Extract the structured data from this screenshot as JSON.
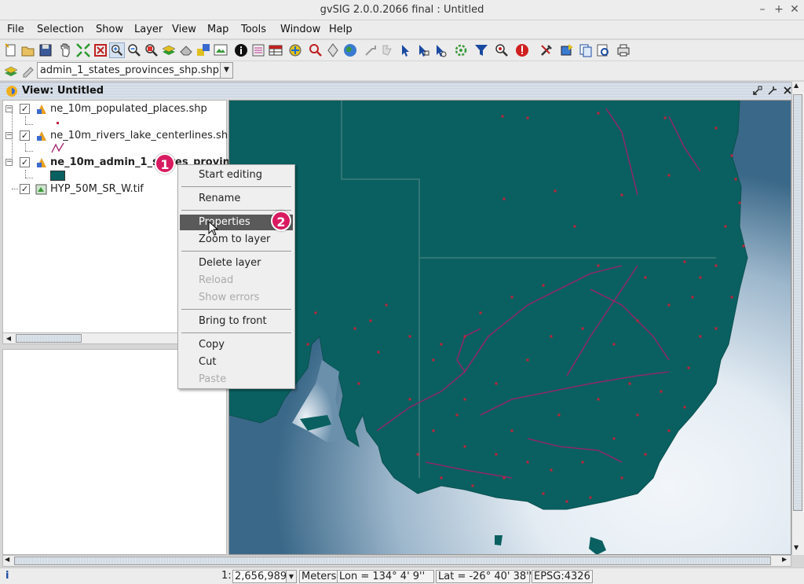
{
  "window": {
    "title": "gvSIG 2.0.0.2066 final : Untitled",
    "controls": [
      "–",
      "+",
      "✕"
    ]
  },
  "menubar": {
    "items": [
      "File",
      "Selection",
      "Show",
      "Layer",
      "View",
      "Map",
      "Tools",
      "Window",
      "Help"
    ]
  },
  "toolbar": {
    "active_layer_combo": "ne_10m_admin_1_states_provinces_shp.shp",
    "buttons": [
      "new-icon",
      "open-icon",
      "save-icon",
      "pan-icon",
      "zoom-extent-icon",
      "full-extent-icon",
      "zoom-in-icon",
      "zoom-out-icon",
      "zoom-select-icon",
      "layers-icon",
      "eraser-icon",
      "add-layer-icon",
      "map-frame-icon",
      "info-icon",
      "selection-icon",
      "table-icon",
      "locator-icon",
      "zoom-to-point-icon",
      "globe-icon",
      "geo-icon",
      "hyperlink-icon",
      "select-pointer-icon",
      "select-rect-icon",
      "select-polygon-icon",
      "gear-icon",
      "filter-icon",
      "error-icon",
      "tools-icon",
      "export-icon",
      "copy-icon",
      "preview-icon",
      "print-icon"
    ]
  },
  "view": {
    "title": "View: Untitled"
  },
  "toc": {
    "layers": [
      {
        "name": "ne_10m_populated_places.shp",
        "checked": true,
        "bold": false
      },
      {
        "name": "ne_10m_rivers_lake_centerlines.shp",
        "checked": true,
        "bold": false
      },
      {
        "name": "ne_10m_admin_1_states_provinces_shp.shp",
        "checked": true,
        "bold": true
      },
      {
        "name": "HYP_50M_SR_W.tif",
        "checked": true,
        "bold": false
      }
    ],
    "fill_color": "#0a6060"
  },
  "context_menu": {
    "items": [
      {
        "label": "Start editing",
        "enabled": true
      },
      {
        "label": "Rename",
        "enabled": true
      },
      {
        "label": "Properties",
        "enabled": true,
        "highlighted": true
      },
      {
        "label": "Zoom to layer",
        "enabled": true
      },
      {
        "label": "Delete layer",
        "enabled": true
      },
      {
        "label": "Reload",
        "enabled": false
      },
      {
        "label": "Show errors",
        "enabled": false
      },
      {
        "label": "Bring to front",
        "enabled": true
      },
      {
        "label": "Copy",
        "enabled": true
      },
      {
        "label": "Cut",
        "enabled": true
      },
      {
        "label": "Paste",
        "enabled": false
      }
    ]
  },
  "annotations": {
    "step1": "1",
    "step2": "2"
  },
  "statusbar": {
    "info_icon": "i",
    "scale_prefix": "1:",
    "scale": "2,656,989",
    "units": "Meters",
    "lon": "Lon = 134° 4' 9''",
    "lat": "Lat = -26° 40' 38''",
    "epsg": "EPSG:4326"
  },
  "colors": {
    "land": "#0a6060",
    "sea_light": "#f2f6fa",
    "sea_dark": "#3a6888",
    "rivers": "#a0206a",
    "places": "#c0223a",
    "badge": "#d81b60"
  }
}
